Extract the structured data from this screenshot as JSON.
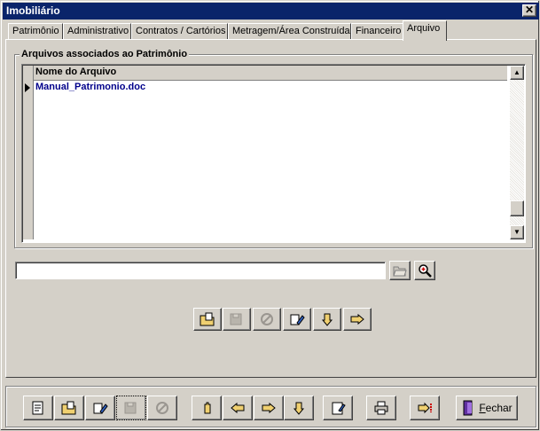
{
  "window": {
    "title": "Imobiliário",
    "close_glyph": "✕"
  },
  "tabs": [
    {
      "label": "Patrimônio",
      "active": false
    },
    {
      "label": "Administrativo",
      "active": false
    },
    {
      "label": "Contratos / Cartórios",
      "active": false
    },
    {
      "label": "Metragem/Área Construída",
      "active": false
    },
    {
      "label": "Financeiro",
      "active": false
    },
    {
      "label": "Arquivo",
      "active": true
    }
  ],
  "files_group": {
    "label": "Arquivos associados ao Patrimônio",
    "column_header": "Nome do Arquivo",
    "rows": [
      "Manual_Patrimonio.doc"
    ]
  },
  "path_field": {
    "value": ""
  },
  "path_buttons": [
    {
      "icon": "folder-open-icon"
    },
    {
      "icon": "zoom-icon"
    }
  ],
  "file_toolbar": [
    {
      "icon": "open-file-icon",
      "enabled": true
    },
    {
      "icon": "save-file-icon",
      "enabled": false
    },
    {
      "icon": "cancel-icon",
      "enabled": false
    },
    {
      "icon": "edit-icon",
      "enabled": true
    },
    {
      "icon": "pointer-down-icon",
      "enabled": true
    },
    {
      "icon": "pointer-right-icon",
      "enabled": true
    }
  ],
  "bottom_toolbar": [
    {
      "icon": "new-record-icon",
      "enabled": true
    },
    {
      "icon": "open-record-icon",
      "enabled": true
    },
    {
      "icon": "edit-record-icon",
      "enabled": true
    },
    {
      "icon": "save-record-icon",
      "enabled": false
    },
    {
      "icon": "cancel-icon",
      "enabled": false
    },
    {
      "icon": "first-record-icon",
      "enabled": true
    },
    {
      "icon": "previous-record-icon",
      "enabled": true
    },
    {
      "icon": "next-record-icon",
      "enabled": true
    },
    {
      "icon": "last-record-icon",
      "enabled": true
    },
    {
      "icon": "notes-icon",
      "enabled": true
    },
    {
      "icon": "print-icon",
      "enabled": true
    },
    {
      "icon": "export-icon",
      "enabled": true
    }
  ],
  "close_button": {
    "label_underlined": "F",
    "label_rest": "echar",
    "icon": "door-exit-icon"
  }
}
